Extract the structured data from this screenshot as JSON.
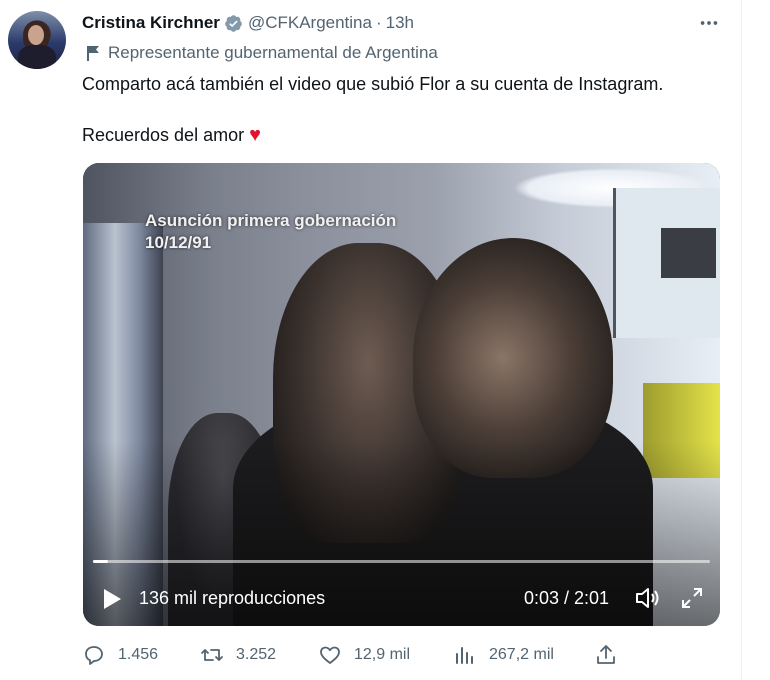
{
  "tweet": {
    "author_name": "Cristina Kirchner",
    "handle": "@CFKArgentina",
    "separator": "·",
    "time": "13h",
    "more_icon": "more-horizontal-icon",
    "label": "Representante gubernamental de Argentina",
    "text_line1": "Comparto acá también el video que subió Flor a su cuenta de Instagram.",
    "text_line2": "Recuerdos del amor",
    "heart_emoji": "♥",
    "colors": {
      "verified": "#829aab",
      "heart": "#e0142b",
      "text": "#0f1419",
      "secondary": "#536471"
    }
  },
  "video": {
    "caption_line1": "Asunción primera gobernación",
    "caption_line2": "10/12/91",
    "views": "136 mil reproducciones",
    "timecode": "0:03 / 2:01",
    "progress_fraction": 0.025
  },
  "actions": {
    "replies": "1.456",
    "retweets": "3.252",
    "likes": "12,9 mil",
    "views": "267,2 mil"
  }
}
